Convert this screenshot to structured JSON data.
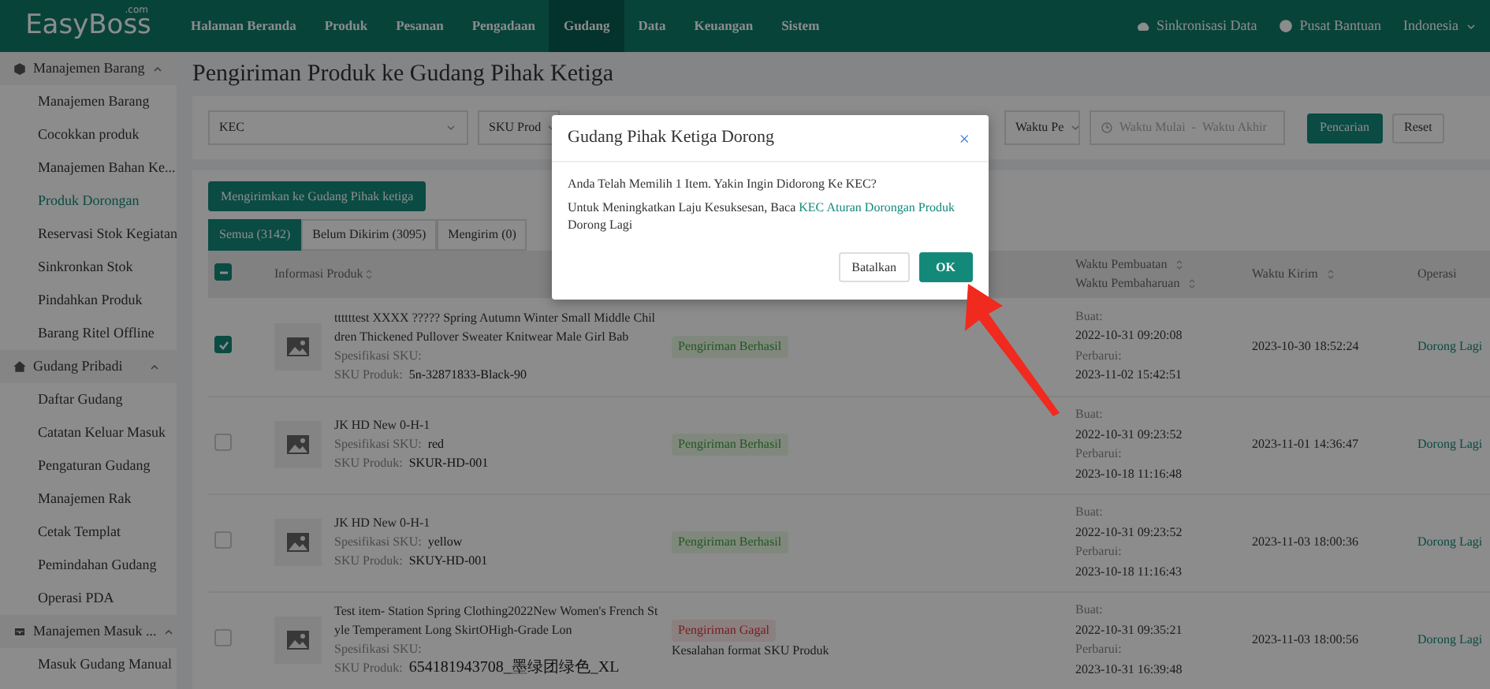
{
  "brand": {
    "name": "EasyBoss",
    "suffix": ".com"
  },
  "nav": [
    {
      "label": "Halaman Beranda",
      "selected": false
    },
    {
      "label": "Produk",
      "selected": false
    },
    {
      "label": "Pesanan",
      "selected": false
    },
    {
      "label": "Pengadaan",
      "selected": false
    },
    {
      "label": "Gudang",
      "selected": true
    },
    {
      "label": "Data",
      "selected": false
    },
    {
      "label": "Keuangan",
      "selected": false
    },
    {
      "label": "Sistem",
      "selected": false
    }
  ],
  "top_right": {
    "sync": "Sinkronisasi Data",
    "help": "Pusat Bantuan",
    "language": "Indonesia"
  },
  "sidebar": [
    {
      "title": "Manajemen Barang",
      "expanded": true,
      "items": [
        {
          "label": "Manajemen Barang",
          "selected": false
        },
        {
          "label": "Cocokkan produk",
          "selected": false
        },
        {
          "label": "Manajemen Bahan Ke...",
          "selected": false
        },
        {
          "label": "Produk Dorongan",
          "selected": true
        },
        {
          "label": "Reservasi Stok Kegiatan",
          "selected": false
        },
        {
          "label": "Sinkronkan Stok",
          "selected": false
        },
        {
          "label": "Pindahkan Produk",
          "selected": false
        },
        {
          "label": "Barang Ritel Offline",
          "selected": false
        }
      ]
    },
    {
      "title": "Gudang Pribadi",
      "expanded": true,
      "items": [
        {
          "label": "Daftar Gudang",
          "selected": false
        },
        {
          "label": "Catatan Keluar Masuk",
          "selected": false
        },
        {
          "label": "Pengaturan Gudang",
          "selected": false
        },
        {
          "label": "Manajemen Rak",
          "selected": false
        },
        {
          "label": "Cetak Templat",
          "selected": false
        },
        {
          "label": "Pemindahan Gudang",
          "selected": false
        },
        {
          "label": "Operasi PDA",
          "selected": false
        }
      ]
    },
    {
      "title": "Manajemen Masuk ...",
      "expanded": true,
      "items": [
        {
          "label": "Masuk Gudang Manual",
          "selected": false
        }
      ]
    }
  ],
  "page_title": "Pengiriman Produk ke Gudang Pihak Ketiga",
  "filters": {
    "store": "KEC",
    "sku_field": "SKU Prod",
    "time_field": "Waktu Pe",
    "date_start_placeholder": "Waktu Mulai",
    "date_separator": "-",
    "date_end_placeholder": "Waktu Akhir",
    "search_button": "Pencarian",
    "reset_button": "Reset"
  },
  "action_button": "Mengirimkan ke Gudang Pihak ketiga",
  "tabs": [
    {
      "label": "Semua (3142)",
      "selected": true
    },
    {
      "label": "Belum Dikirim (3095)",
      "selected": false
    },
    {
      "label": "Mengirim (0)",
      "selected": false
    }
  ],
  "table": {
    "header_checkbox": {
      "indeterminate": true
    },
    "columns": {
      "product": "Informasi Produk",
      "created": "Waktu Pembuatan",
      "updated": "Waktu Pembaharuan",
      "sent": "Waktu Kirim",
      "operation": "Operasi"
    },
    "rows": [
      {
        "checked": true,
        "name": "ttttttest XXXX ????? Spring Autumn Winter Small Middle Children Thickened Pullover Sweater Knitwear Male Girl Bab",
        "spec_label": "Spesifikasi SKU:",
        "spec": "",
        "sku_label": "SKU Produk:",
        "sku": "5n-32871833-Black-90",
        "status": {
          "kind": "success",
          "label": "Pengiriman Berhasil"
        },
        "created_label": "Buat:",
        "created": "2022-10-31 09:20:08",
        "updated_label": "Perbarui:",
        "updated": "2023-11-02 15:42:51",
        "sent": "2023-10-30 18:52:24",
        "action": "Dorong Lagi"
      },
      {
        "checked": false,
        "name": "JK HD New 0-H-1",
        "spec_label": "Spesifikasi SKU:",
        "spec": "red",
        "sku_label": "SKU Produk:",
        "sku": "SKUR-HD-001",
        "status": {
          "kind": "success",
          "label": "Pengiriman Berhasil"
        },
        "created_label": "Buat:",
        "created": "2022-10-31 09:23:52",
        "updated_label": "Perbarui:",
        "updated": "2023-10-18 11:16:48",
        "sent": "2023-11-01 14:36:47",
        "action": "Dorong Lagi"
      },
      {
        "checked": false,
        "name": "JK HD New 0-H-1",
        "spec_label": "Spesifikasi SKU:",
        "spec": "yellow",
        "sku_label": "SKU Produk:",
        "sku": "SKUY-HD-001",
        "status": {
          "kind": "success",
          "label": "Pengiriman Berhasil"
        },
        "created_label": "Buat:",
        "created": "2022-10-31 09:23:52",
        "updated_label": "Perbarui:",
        "updated": "2023-10-18 11:16:43",
        "sent": "2023-11-03 18:00:36",
        "action": "Dorong Lagi"
      },
      {
        "checked": false,
        "name": "Test item- Station Spring Clothing2022New Women's French Style Temperament Long SkirtOHigh-Grade Lon",
        "spec_label": "Spesifikasi SKU:",
        "spec": "",
        "sku_label": "SKU Produk:",
        "sku": "654181943708_墨绿团绿色_XL",
        "status": {
          "kind": "failed",
          "label": "Pengiriman Gagal",
          "note": "Kesalahan format SKU Produk"
        },
        "created_label": "Buat:",
        "created": "2022-10-31 09:35:21",
        "updated_label": "Perbarui:",
        "updated": "2023-10-31 16:39:48",
        "sent": "2023-11-03 18:00:56",
        "action": "Dorong Lagi"
      }
    ]
  },
  "modal": {
    "title": "Gudang Pihak Ketiga Dorong",
    "close": "×",
    "message": "Anda Telah Memilih 1 Item. Yakin Ingin Didorong Ke KEC?",
    "note_before": "Untuk Meningkatkan Laju Kesuksesan, Baca",
    "note_link": "KEC Aturan Dorongan Produk",
    "note_after": "Dorong Lagi",
    "cancel": "Batalkan",
    "ok": "OK"
  }
}
